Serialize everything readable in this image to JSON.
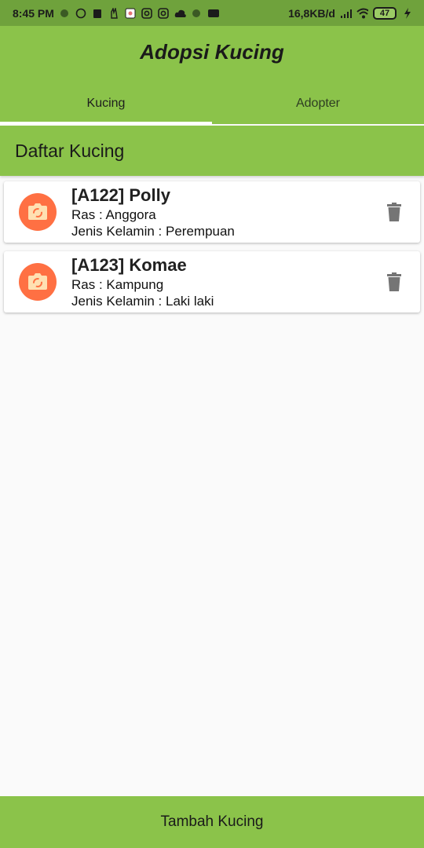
{
  "status_bar": {
    "time": "8:45 PM",
    "network_speed": "16,8KB/d",
    "battery": "47",
    "left_icons": [
      "circle-icon",
      "whatsapp-icon",
      "clipboard-icon",
      "peace-icon",
      "image-icon",
      "instagram-icon",
      "instagram-icon",
      "cloud-icon",
      "circle-icon",
      "chat-icon"
    ],
    "right_icons": [
      "signal-icon",
      "wifi-icon",
      "battery-icon",
      "charging-icon"
    ]
  },
  "app_bar": {
    "title": "Adopsi Kucing",
    "tabs": [
      {
        "label": "Kucing",
        "selected": true
      },
      {
        "label": "Adopter",
        "selected": false
      }
    ]
  },
  "section": {
    "title": "Daftar Kucing"
  },
  "cats": [
    {
      "title": "[A122] Polly",
      "ras": "Ras : Anggora",
      "gender": "Jenis Kelamin : Perempuan",
      "icon": "camera-icon",
      "action_icon": "trash-icon"
    },
    {
      "title": "[A123] Komae",
      "ras": "Ras : Kampung",
      "gender": "Jenis Kelamin : Laki laki",
      "icon": "camera-icon",
      "action_icon": "trash-icon"
    }
  ],
  "bottom_button": {
    "label": "Tambah Kucing"
  },
  "colors": {
    "status_bar": "#6fa23c",
    "primary": "#8bc34a",
    "avatar": "#ff7043",
    "background": "#fafafa",
    "indicator": "#ffffff"
  }
}
